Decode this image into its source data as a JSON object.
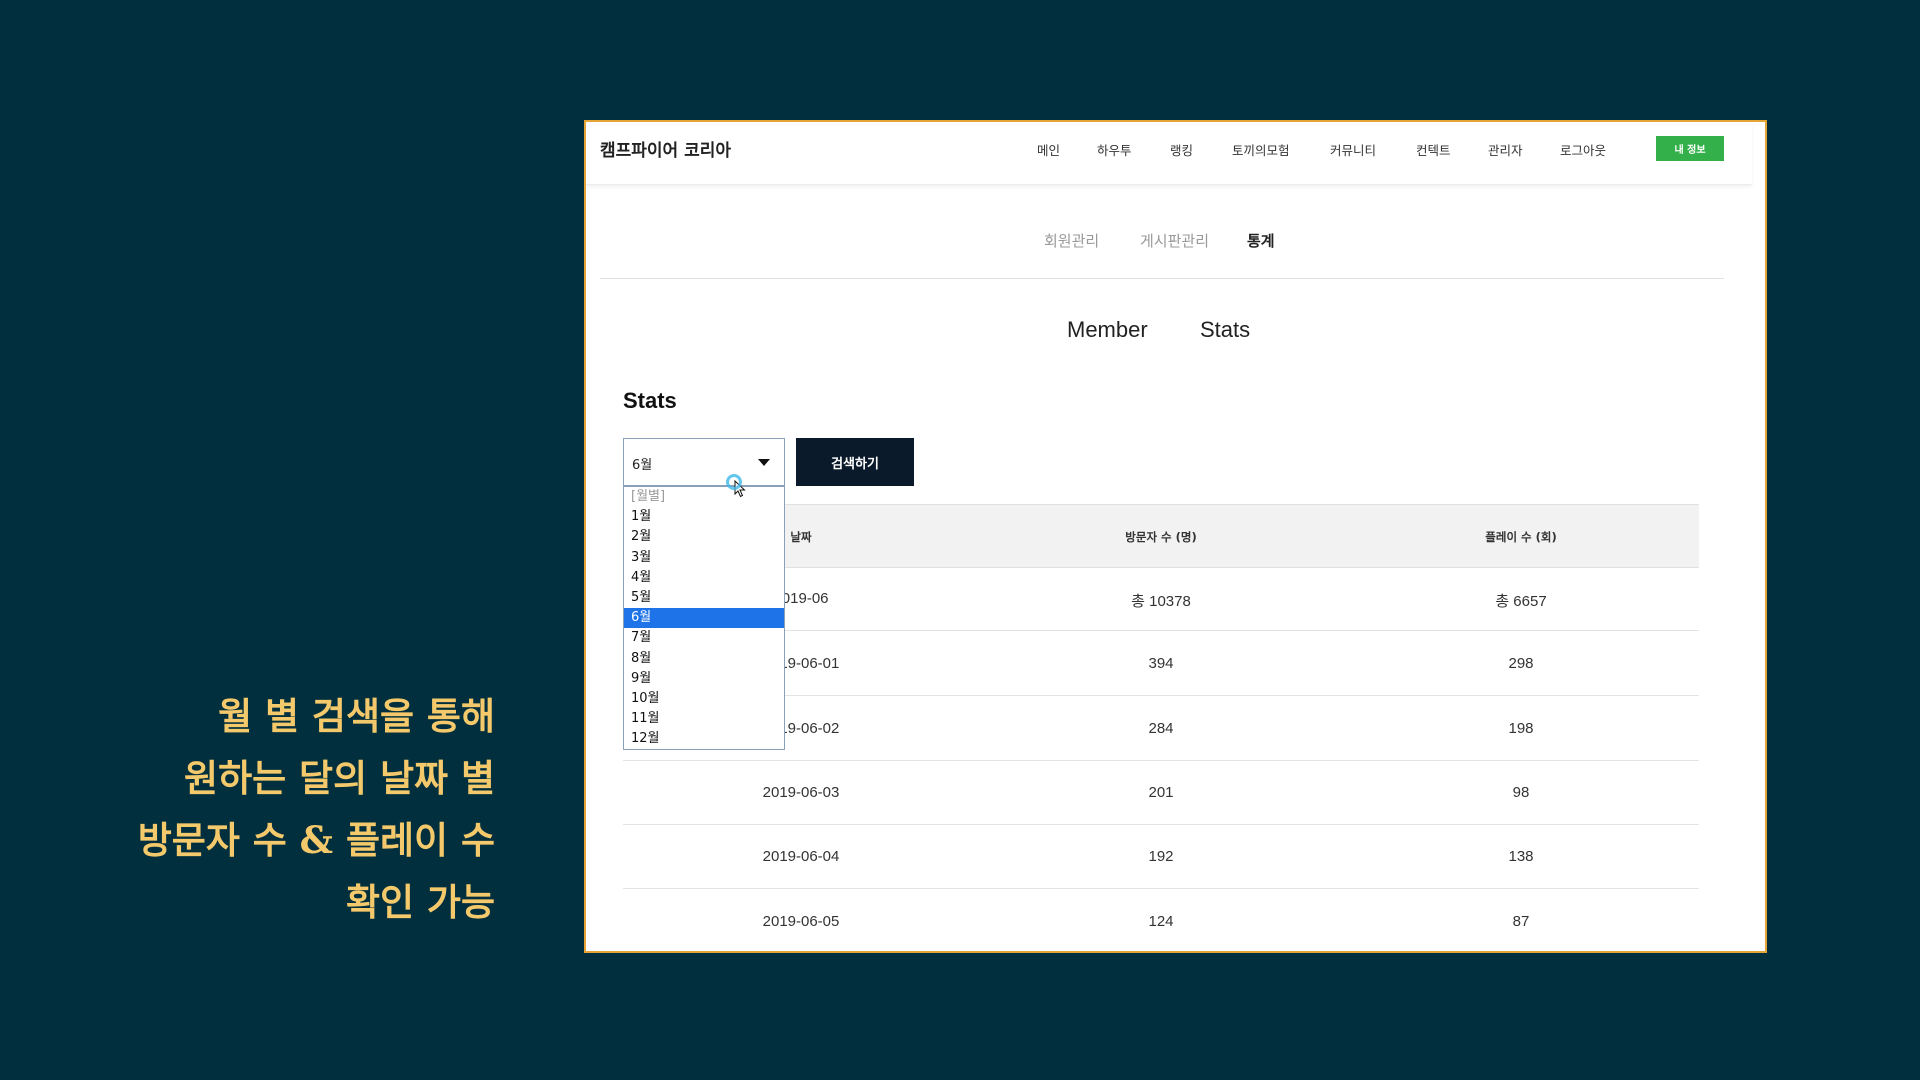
{
  "caption": {
    "lines": [
      "월 별 검색을 통해",
      "원하는 달의 날짜 별",
      "방문자 수 & 플레이 수",
      "확인 가능"
    ]
  },
  "site": {
    "brand": "캠프파이어 코리아",
    "nav": [
      "메인",
      "하우투",
      "랭킹",
      "토끼의모험",
      "커뮤니티",
      "컨텍트",
      "관리자",
      "로그아웃"
    ],
    "my_info_button": "내 정보"
  },
  "admin_tabs": {
    "items": [
      "회원관리",
      "게시판관리",
      "통계"
    ],
    "active": "통계"
  },
  "section_tabs": [
    "Member",
    "Stats"
  ],
  "stats": {
    "title": "Stats",
    "month_select": {
      "selected": "6월",
      "options": [
        "[월별]",
        "1월",
        "2월",
        "3월",
        "4월",
        "5월",
        "6월",
        "7월",
        "8월",
        "9월",
        "10월",
        "11월",
        "12월"
      ],
      "highlighted": "6월"
    },
    "search_button": "검색하기",
    "table": {
      "headers": [
        "날짜",
        "방문자 수 (명)",
        "플레이 수 (회)"
      ],
      "rows": [
        [
          "2019-06",
          "총 10378",
          "총 6657"
        ],
        [
          "2019-06-01",
          "394",
          "298"
        ],
        [
          "2019-06-02",
          "284",
          "198"
        ],
        [
          "2019-06-03",
          "201",
          "98"
        ],
        [
          "2019-06-04",
          "192",
          "138"
        ],
        [
          "2019-06-05",
          "124",
          "87"
        ]
      ]
    }
  }
}
